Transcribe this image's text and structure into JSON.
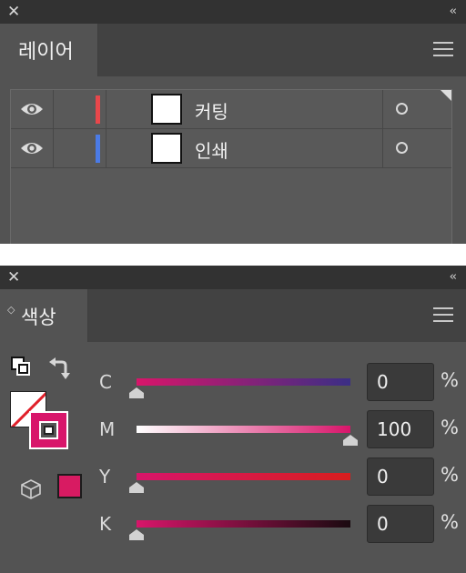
{
  "layers_panel": {
    "tab_label": "레이어",
    "close_glyph": "✕",
    "collapse_glyph": "‹‹",
    "layers": [
      {
        "name": "커팅",
        "color": "#e8474b"
      },
      {
        "name": "인쇄",
        "color": "#4b7be6"
      }
    ],
    "icons": [
      "close-icon",
      "collapse-icon",
      "menu-icon",
      "eye-icon",
      "target-circle-icon"
    ]
  },
  "color_panel": {
    "tab_label": "색상",
    "close_glyph": "✕",
    "collapse_glyph": "‹‹",
    "updown_glyph": "◇",
    "fill_color": "none",
    "stroke_color": "#d8156a",
    "out_of_gamut_color": "#d81b62",
    "percent_symbol": "%",
    "channels": [
      {
        "label": "C",
        "value": "0",
        "from": "#d8156a",
        "to": "#3b2e85"
      },
      {
        "label": "M",
        "value": "100",
        "from": "#ffffff",
        "to": "#d8156a"
      },
      {
        "label": "Y",
        "value": "0",
        "from": "#d8156a",
        "to": "#d81e1e"
      },
      {
        "label": "K",
        "value": "0",
        "from": "#d8156a",
        "to": "#1a0a10"
      }
    ]
  },
  "colors": {
    "panel_bg": "#535353",
    "titlebar_bg": "#323232",
    "tabstrip_bg": "#424242"
  }
}
